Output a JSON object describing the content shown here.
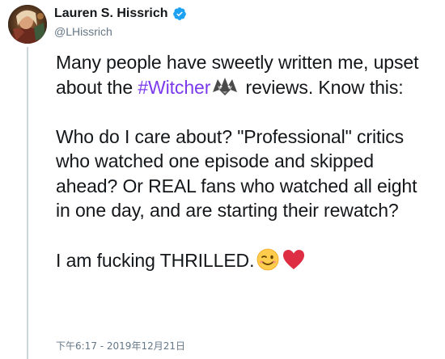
{
  "author": {
    "display_name": "Lauren S. Hissrich",
    "handle": "@LHissrich",
    "verified": true,
    "avatar_icon": "profile-photo"
  },
  "tweet": {
    "para1_part1": "Many people have sweetly written me, upset about the ",
    "hashtag": "#Witcher",
    "hashtag_emoji": "witcher-wolf-medallion-icon",
    "para1_part2": " reviews. Know this:",
    "para2": "Who do I care about? \"Professional\" critics who watched one episode and skipped ahead? Or REAL fans who watched all eight in one day, and are starting their rewatch?",
    "para3": "I am fucking THRILLED.",
    "trailing_emojis": [
      "winking-face-icon",
      "red-heart-icon"
    ],
    "timestamp": "下午6:17 - 2019年12月21日"
  },
  "colors": {
    "text": "#14171a",
    "secondary": "#657786",
    "hashtag": "#7c3aed",
    "verified": "#1da1f2",
    "thread_line": "#ccd6dd",
    "heart": "#e0245e"
  }
}
